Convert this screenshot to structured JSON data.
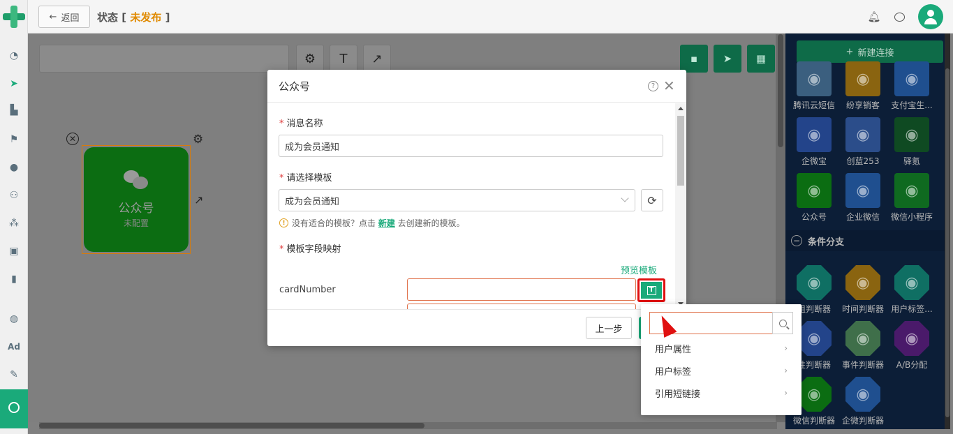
{
  "topbar": {
    "back_label": "返回",
    "status_prefix": "状态",
    "status_open": " [ ",
    "status_value": "未发布",
    "status_close": " ]",
    "status_color": "#e08a00"
  },
  "canvas": {
    "node": {
      "title": "公众号",
      "subtitle": "未配置"
    }
  },
  "right_panel": {
    "new_connection_label": "新建连接",
    "tiles_top": [
      {
        "label": "腾讯云短信",
        "icon": "cloud-icon",
        "color": "#3b5f7f"
      },
      {
        "label": "纷享销客",
        "icon": "robot-icon",
        "color": "#8a6410"
      },
      {
        "label": "支付宝生...",
        "icon": "chat-box-icon",
        "color": "#1f4f8f"
      },
      {
        "label": "企微宝",
        "icon": "ghost-icon",
        "color": "#23448a"
      },
      {
        "label": "创蓝253",
        "icon": "cubes-icon",
        "color": "#2b4d8a"
      },
      {
        "label": "驿氪",
        "icon": "spider-icon",
        "color": "#0f4a22"
      },
      {
        "label": "公众号",
        "icon": "wechat-icon",
        "color": "#0b6d12"
      },
      {
        "label": "企业微信",
        "icon": "bubble-icon",
        "color": "#1f4f8f"
      },
      {
        "label": "微信小程序",
        "icon": "mini-program-icon",
        "color": "#0f6a20"
      }
    ],
    "section_label": "条件分支",
    "tiles_branch": [
      {
        "label": "组判断器",
        "icon": "user-group-icon",
        "color": "#0f6f63"
      },
      {
        "label": "时间判断器",
        "icon": "user-clock-icon",
        "color": "#8a6410"
      },
      {
        "label": "用户标签...",
        "icon": "user-tag-icon",
        "color": "#0f6f63"
      },
      {
        "label": "性判断器",
        "icon": "edit-icon",
        "color": "#23448a"
      },
      {
        "label": "事件判断器",
        "icon": "list-icon",
        "color": "#3f6f4a"
      },
      {
        "label": "A/B分配",
        "icon": "split-icon",
        "color": "#4a1a6a"
      },
      {
        "label": "微信判断器",
        "icon": "wechat-icon",
        "color": "#0b6d12"
      },
      {
        "label": "企微判断器",
        "icon": "bubble-icon",
        "color": "#1f4f8f"
      }
    ]
  },
  "modal": {
    "title": "公众号",
    "field_name_label": "消息名称",
    "field_name_value": "成为会员通知",
    "field_template_label": "请选择模板",
    "field_template_value": "成为会员通知",
    "hint_before": "没有适合的模板？点击 ",
    "hint_link": "新建",
    "hint_after": " 去创建新的模板。",
    "mapping_label": "模板字段映射",
    "preview_label": "预览模板",
    "mapping_key": "cardNumber",
    "prev_label": "上一步"
  },
  "dropdown": {
    "search_value": "",
    "items": [
      "用户属性",
      "用户标签",
      "引用短链接"
    ]
  },
  "colors": {
    "accent": "#1aaa7a",
    "highlight": "#e01010"
  }
}
